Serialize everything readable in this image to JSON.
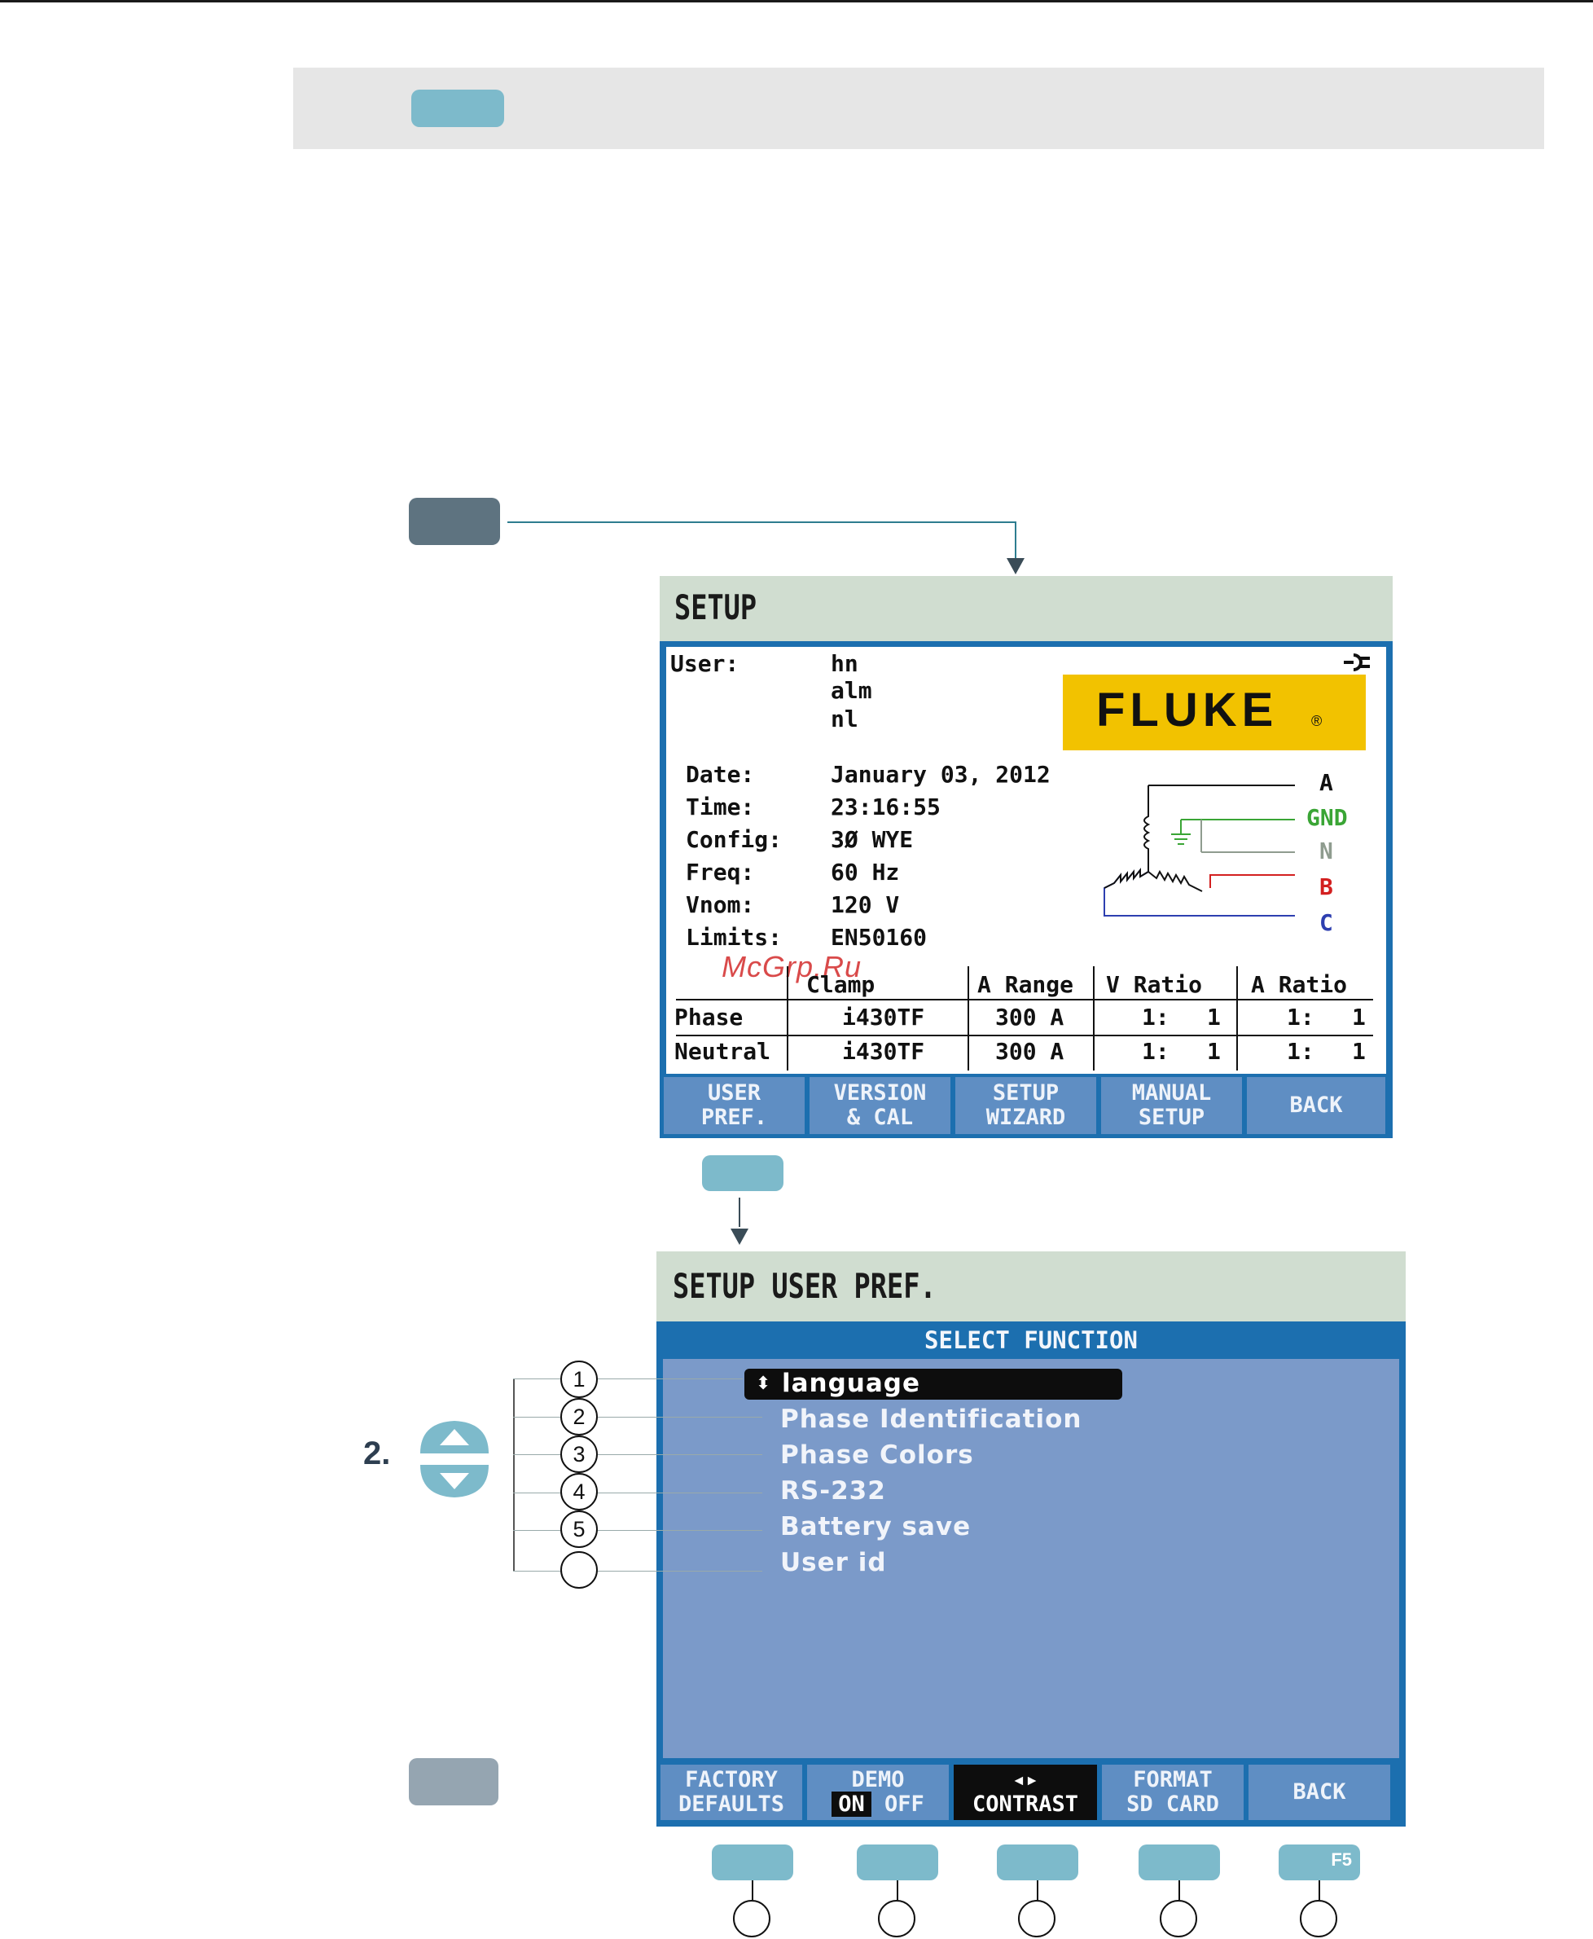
{
  "setup_screen": {
    "title": "SETUP",
    "user_label": "User:",
    "user_lines": [
      "hn",
      "alm",
      "nl"
    ],
    "logo": "FLUKE",
    "fields": [
      {
        "label": "Date:",
        "value": "January 03, 2012"
      },
      {
        "label": "Time:",
        "value": "23:16:55"
      },
      {
        "label": "Config:",
        "value": "3Ø WYE"
      },
      {
        "label": "Freq:",
        "value": "60 Hz"
      },
      {
        "label": "Vnom:",
        "value": "120 V"
      },
      {
        "label": "Limits:",
        "value": "EN50160"
      }
    ],
    "phases": {
      "a": "A",
      "gnd": "GND",
      "n": "N",
      "b": "B",
      "c": "C"
    },
    "phase_colors": {
      "a": "#111111",
      "gnd": "#3aa535",
      "n": "#8f9c8f",
      "b": "#d32020",
      "c": "#2e3fb0"
    },
    "table": {
      "headers": [
        "Clamp",
        "A Range",
        "V Ratio",
        "A Ratio"
      ],
      "rows": [
        {
          "label": "Phase",
          "clamp": "i430TF",
          "range": "300 A",
          "v1": "1:",
          "v2": "1",
          "a1": "1:",
          "a2": "1"
        },
        {
          "label": "Neutral",
          "clamp": "i430TF",
          "range": "300 A",
          "v1": "1:",
          "v2": "1",
          "a1": "1:",
          "a2": "1"
        }
      ]
    },
    "watermark": "McGrp.Ru",
    "softkeys": [
      {
        "line1": "USER",
        "line2": "PREF."
      },
      {
        "line1": "VERSION",
        "line2": "& CAL"
      },
      {
        "line1": "SETUP",
        "line2": "WIZARD"
      },
      {
        "line1": "MANUAL",
        "line2": "SETUP"
      },
      {
        "line1": "BACK",
        "line2": ""
      }
    ]
  },
  "user_pref_screen": {
    "title": "SETUP USER PREF.",
    "header": "SELECT FUNCTION",
    "items": [
      "language",
      "Phase Identification",
      "Phase Colors",
      "RS-232",
      "Battery save",
      "User id"
    ],
    "callouts": [
      "1",
      "2",
      "3",
      "4",
      "5",
      ""
    ],
    "softkeys": {
      "factory": {
        "line1": "FACTORY",
        "line2": "DEFAULTS"
      },
      "demo": {
        "line1": "DEMO",
        "on": "ON",
        "off": "OFF"
      },
      "contrast": {
        "line1": "◂▸",
        "line2": "CONTRAST"
      },
      "format": {
        "line1": "FORMAT",
        "line2": "SD CARD"
      },
      "back": {
        "line1": "BACK",
        "line2": ""
      }
    }
  },
  "step_label": "2.",
  "f5_label": "F5",
  "colors": {
    "teal_key": "#7dbacb",
    "slate_key": "#5e7380",
    "screen_blue": "#1c6faf",
    "panel_blue": "#7b9ac9",
    "title_green": "#d0ddd0"
  }
}
